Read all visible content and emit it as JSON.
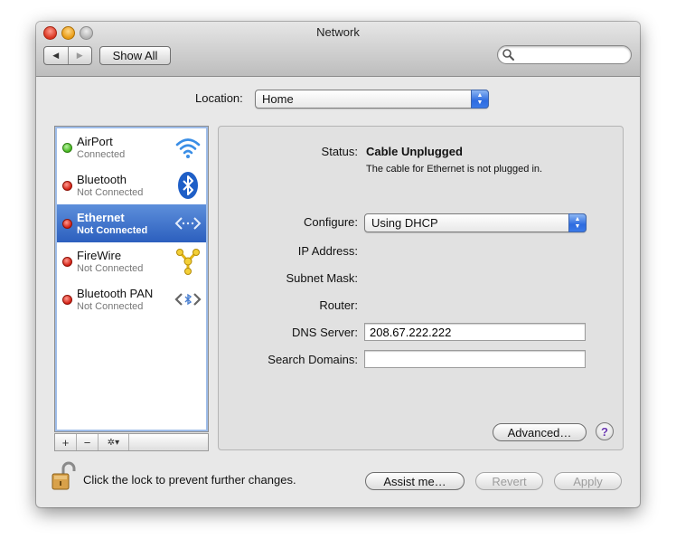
{
  "window": {
    "title": "Network"
  },
  "toolbar": {
    "back_glyph": "◀",
    "forward_glyph": "▶",
    "show_all_label": "Show All",
    "search_placeholder": ""
  },
  "location": {
    "label": "Location:",
    "value": "Home"
  },
  "services": [
    {
      "name": "AirPort",
      "status": "Connected",
      "dot": "green",
      "icon": "wifi-icon",
      "selected": false
    },
    {
      "name": "Bluetooth",
      "status": "Not Connected",
      "dot": "red",
      "icon": "bluetooth-icon",
      "selected": false
    },
    {
      "name": "Ethernet",
      "status": "Not Connected",
      "dot": "red",
      "icon": "ethernet-icon",
      "selected": true
    },
    {
      "name": "FireWire",
      "status": "Not Connected",
      "dot": "red",
      "icon": "firewire-icon",
      "selected": false
    },
    {
      "name": "Bluetooth PAN",
      "status": "Not Connected",
      "dot": "red",
      "icon": "bluetooth-pan-icon",
      "selected": false
    }
  ],
  "list_toolbar": {
    "add_label": "+",
    "remove_label": "−",
    "action_label": "✲▾"
  },
  "details": {
    "status_label": "Status:",
    "status_value": "Cable Unplugged",
    "status_description": "The cable for Ethernet is not plugged in.",
    "configure_label": "Configure:",
    "configure_value": "Using DHCP",
    "ip_label": "IP Address:",
    "subnet_label": "Subnet Mask:",
    "router_label": "Router:",
    "dns_label": "DNS Server:",
    "dns_value": "208.67.222.222",
    "search_domains_label": "Search Domains:",
    "search_domains_value": "",
    "advanced_label": "Advanced…",
    "help_label": "?"
  },
  "footer": {
    "lock_text": "Click the lock to prevent further changes.",
    "assist_label": "Assist me…",
    "revert_label": "Revert",
    "apply_label": "Apply"
  },
  "colors": {
    "selection": "#3c6fcc",
    "status_green": "#42b51c",
    "status_red": "#d21c10",
    "popup_blue": "#2d6be0"
  }
}
